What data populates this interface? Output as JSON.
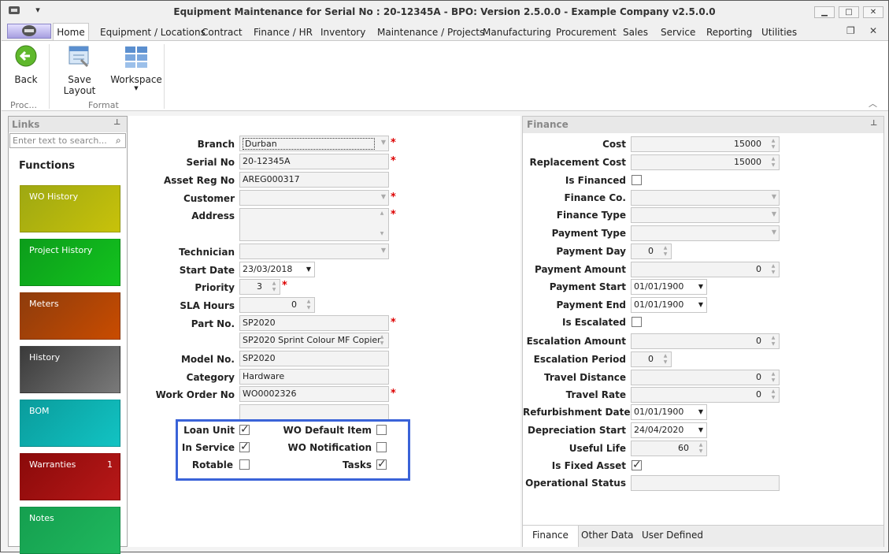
{
  "window": {
    "title": "Equipment Maintenance for Serial No : 20-12345A - BPO: Version 2.5.0.0 - Example Company v2.5.0.0",
    "minimize": "▁",
    "maximize": "□",
    "close": "✕",
    "restore": "❐",
    "close2": "✕",
    "quick_access": "▾"
  },
  "menu": {
    "home": "Home",
    "tabs": [
      "Equipment / Locations",
      "Contract",
      "Finance / HR",
      "Inventory",
      "Maintenance / Projects",
      "Manufacturing",
      "Procurement",
      "Sales",
      "Service",
      "Reporting",
      "Utilities"
    ]
  },
  "ribbon": {
    "back": "Back",
    "save_layout": "Save Layout",
    "workspace": "Workspace",
    "group_process": "Proc...",
    "group_format": "Format"
  },
  "links": {
    "header": "Links",
    "search_placeholder": "Enter text to search...",
    "functions": "Functions",
    "tiles": [
      {
        "label": "WO History",
        "badge": ""
      },
      {
        "label": "Project History",
        "badge": ""
      },
      {
        "label": "Meters",
        "badge": ""
      },
      {
        "label": "History",
        "badge": ""
      },
      {
        "label": "BOM",
        "badge": ""
      },
      {
        "label": "Warranties",
        "badge": "1"
      },
      {
        "label": "Notes",
        "badge": ""
      }
    ]
  },
  "form": {
    "branch": {
      "label": "Branch",
      "value": "Durban"
    },
    "serial_no": {
      "label": "Serial No",
      "value": "20-12345A"
    },
    "asset_reg_no": {
      "label": "Asset Reg No",
      "value": "AREG000317"
    },
    "customer": {
      "label": "Customer",
      "value": ""
    },
    "address": {
      "label": "Address",
      "value": ""
    },
    "technician": {
      "label": "Technician",
      "value": ""
    },
    "start_date": {
      "label": "Start Date",
      "value": "23/03/2018"
    },
    "priority": {
      "label": "Priority",
      "value": "3"
    },
    "sla_hours": {
      "label": "SLA Hours",
      "value": "0"
    },
    "part_no": {
      "label": "Part No.",
      "value": "SP2020",
      "description": "SP2020 Sprint Colour MF Copier"
    },
    "model_no": {
      "label": "Model No.",
      "value": "SP2020"
    },
    "category": {
      "label": "Category",
      "value": "Hardware"
    },
    "work_order_no": {
      "label": "Work Order No",
      "value": "WO0002326"
    },
    "checks": {
      "loan_unit": "Loan Unit",
      "in_service": "In Service",
      "rotable": "Rotable",
      "wo_default_item": "WO Default Item",
      "wo_notification": "WO Notification",
      "tasks": "Tasks"
    },
    "required_mark": "*"
  },
  "finance": {
    "header": "Finance",
    "cost": {
      "label": "Cost",
      "value": "15000"
    },
    "replacement_cost": {
      "label": "Replacement Cost",
      "value": "15000"
    },
    "is_financed": "Is Financed",
    "finance_co": "Finance Co.",
    "finance_type": "Finance Type",
    "payment_type": "Payment Type",
    "payment_day": {
      "label": "Payment Day",
      "value": "0"
    },
    "payment_amount": {
      "label": "Payment Amount",
      "value": "0"
    },
    "payment_start": {
      "label": "Payment Start",
      "value": "01/01/1900"
    },
    "payment_end": {
      "label": "Payment End",
      "value": "01/01/1900"
    },
    "is_escalated": "Is Escalated",
    "escalation_amount": {
      "label": "Escalation Amount",
      "value": "0"
    },
    "escalation_period": {
      "label": "Escalation Period",
      "value": "0"
    },
    "travel_distance": {
      "label": "Travel Distance",
      "value": "0"
    },
    "travel_rate": {
      "label": "Travel Rate",
      "value": "0"
    },
    "refurbishment_date": {
      "label": "Refurbishment Date",
      "value": "01/01/1900"
    },
    "depreciation_start": {
      "label": "Depreciation Start",
      "value": "24/04/2020"
    },
    "useful_life": {
      "label": "Useful Life",
      "value": "60"
    },
    "is_fixed_asset": "Is Fixed Asset",
    "operational_status": "Operational Status",
    "tabs": [
      "Finance",
      "Other Data",
      "User Defined"
    ]
  },
  "colors": {
    "accent": "#3a63d8",
    "required": "#dd0000"
  },
  "icons": {
    "back": "back-arrow-icon",
    "save_layout": "save-layout-icon",
    "workspace": "workspace-icon",
    "pin": "pin-icon",
    "search": "search-icon"
  }
}
